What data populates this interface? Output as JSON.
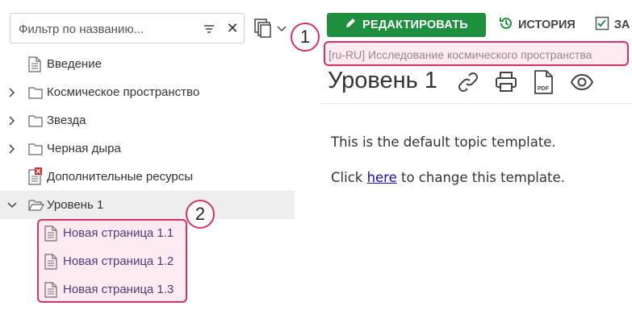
{
  "filter": {
    "placeholder": "Фильтр по названию...",
    "clear_symbol": "✕"
  },
  "tree": {
    "items": [
      {
        "label": "Введение",
        "type": "page"
      },
      {
        "label": "Космическое пространство",
        "type": "folder",
        "expanded": false
      },
      {
        "label": "Звезда",
        "type": "folder",
        "expanded": false
      },
      {
        "label": "Черная дыра",
        "type": "folder",
        "expanded": false
      },
      {
        "label": "Дополнительные ресурсы",
        "type": "page-error"
      },
      {
        "label": "Уровень 1",
        "type": "folder",
        "expanded": true,
        "selected": true
      },
      {
        "label": "Новая страница 1.1",
        "type": "page",
        "level": 2
      },
      {
        "label": "Новая страница 1.2",
        "type": "page",
        "level": 2
      },
      {
        "label": "Новая страница 1.3",
        "type": "page",
        "level": 2
      }
    ]
  },
  "toolbar": {
    "edit_label": "РЕДАКТИРОВАТЬ",
    "history_label": "ИСТОРИЯ",
    "task_label": "ЗА"
  },
  "breadcrumb": "[ru-RU] Исследование космического пространства",
  "topic": {
    "title": "Уровень 1",
    "content_line1": "This is the default topic template.",
    "content_click": "Click ",
    "content_link": "here",
    "content_rest": " to change this template."
  },
  "callouts": {
    "one": "1",
    "two": "2"
  },
  "colors": {
    "accent_green": "#1e8f3e",
    "highlight": "#d4306a",
    "link": "#1a0dab"
  }
}
